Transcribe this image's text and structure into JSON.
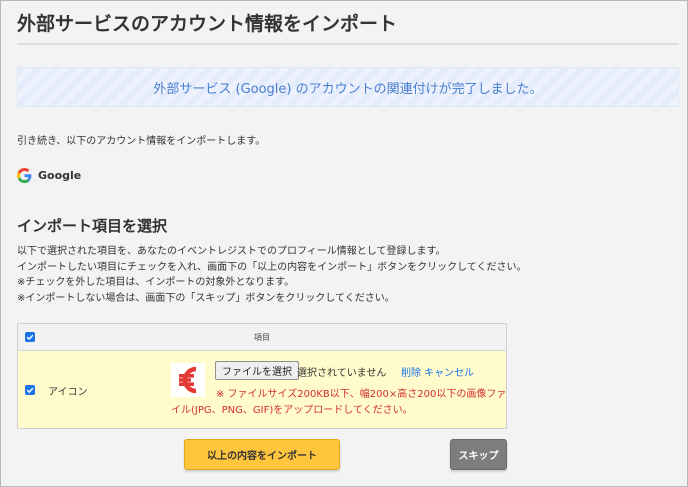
{
  "page": {
    "title": "外部サービスのアカウント情報をインポート"
  },
  "notice": {
    "text": "外部サービス (Google) のアカウントの関連付けが完了しました。",
    "color": "#4a7fd1"
  },
  "intro": "引き続き、以下のアカウント情報をインポートします。",
  "provider": {
    "icon": "google-icon",
    "name": "Google"
  },
  "section": {
    "title": "インポート項目を選択",
    "lines": [
      "以下で選択された項目を、あなたのイベントレジストでのプロフィール情報として登録します。",
      "インポートしたい項目にチェックを入れ、画面下の「以上の内容をインポート」ボタンをクリックしてください。",
      "※チェックを外した項目は、インポートの対象外となります。",
      "※インポートしない場合は、画面下の「スキップ」ボタンをクリックしてください。"
    ]
  },
  "table": {
    "header_label": "項目",
    "select_all_checked": true,
    "rows": [
      {
        "checked": true,
        "label": "アイコン",
        "logo_icon": "eventregist-logo-icon",
        "file_button": "ファイルを選択",
        "file_status": "選択されていません",
        "delete_label": "削除",
        "cancel_label": "キャンセル",
        "note_line1": "※ ファイルサイズ200KB以下、幅200×高さ200以下の画像ファ",
        "note_line2": "イル(JPG、PNG、GIF)をアップロードしてください。"
      }
    ]
  },
  "actions": {
    "import_label": "以上の内容をインポート",
    "skip_label": "スキップ"
  },
  "colors": {
    "accent": "#1a73e8",
    "row_highlight": "#fffbcc",
    "import_button": "#ffc53d",
    "skip_button": "#7d7d7d",
    "note_red": "#d32f2f",
    "logo_red": "#e53935"
  }
}
